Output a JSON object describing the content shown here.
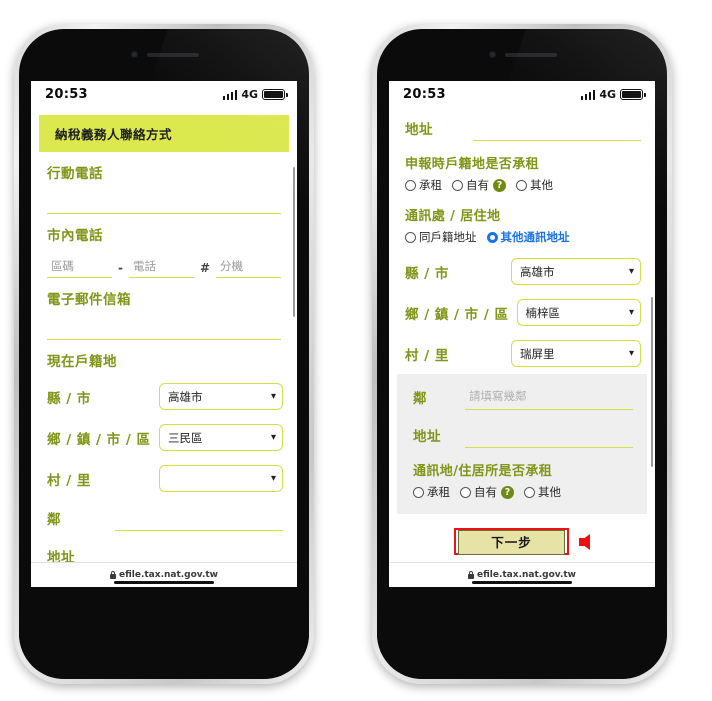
{
  "status_bar": {
    "time": "20:53",
    "network": "4G",
    "signal_icon": "signal-bars-icon",
    "battery_icon": "battery-full-icon"
  },
  "browser": {
    "url": "efile.tax.nat.gov.tw",
    "lock_icon": "lock-icon"
  },
  "left_phone": {
    "section_title": "納稅義務人聯絡方式",
    "mobile": {
      "label": "行動電話",
      "value": ""
    },
    "landline": {
      "label": "市內電話",
      "area_placeholder": "區碼",
      "separator": "-",
      "number_placeholder": "電話",
      "hash": "#",
      "ext_placeholder": "分機"
    },
    "email": {
      "label": "電子郵件信箱",
      "value": ""
    },
    "household_title": "現在戶籍地",
    "selects": [
      {
        "label": "縣 / 市",
        "value": "高雄市"
      },
      {
        "label": "鄉 / 鎮 / 市 / 區",
        "value": "三民區"
      },
      {
        "label": "村 / 里",
        "value": ""
      }
    ],
    "neighborhood": {
      "label": "鄰",
      "value": ""
    },
    "address": {
      "label": "地址",
      "value": ""
    }
  },
  "right_phone": {
    "address_top": {
      "label": "地址",
      "value": ""
    },
    "rent_question_1": {
      "title": "申報時戶籍地是否承租",
      "options": [
        {
          "label": "承租",
          "selected": false,
          "help": false
        },
        {
          "label": "自有",
          "selected": false,
          "help": true
        },
        {
          "label": "其他",
          "selected": false,
          "help": false
        }
      ],
      "help_glyph": "?"
    },
    "contact_place": {
      "title": "通訊處 / 居住地",
      "options": [
        {
          "label": "同戶籍地址",
          "selected": false
        },
        {
          "label": "其他通訊地址",
          "selected": true
        }
      ]
    },
    "selects": [
      {
        "label": "縣 / 市",
        "value": "高雄市"
      },
      {
        "label": "鄉 / 鎮 / 市 / 區",
        "value": "楠梓區"
      },
      {
        "label": "村 / 里",
        "value": "瑞屏里"
      }
    ],
    "neighborhood": {
      "label": "鄰",
      "placeholder": "請填寫幾鄰",
      "value": ""
    },
    "address": {
      "label": "地址",
      "value": ""
    },
    "rent_question_2": {
      "title": "通訊地/住居所是否承租",
      "options": [
        {
          "label": "承租",
          "selected": false,
          "help": false
        },
        {
          "label": "自有",
          "selected": false,
          "help": true
        },
        {
          "label": "其他",
          "selected": false,
          "help": false
        }
      ],
      "help_glyph": "?"
    },
    "next_button": {
      "label": "下一步"
    },
    "annotation": {
      "arrow_icon": "red-arrow-left-icon",
      "highlight_color": "#ee1111"
    }
  },
  "colors": {
    "accent_green": "#cfe04a",
    "header_bar": "#dbe84e",
    "label_text": "#7f9618",
    "selected_radio": "#1a73e8",
    "annotation_red": "#ee1111",
    "button_fill": "#e6e3a5",
    "panel_gray": "#efefef"
  }
}
